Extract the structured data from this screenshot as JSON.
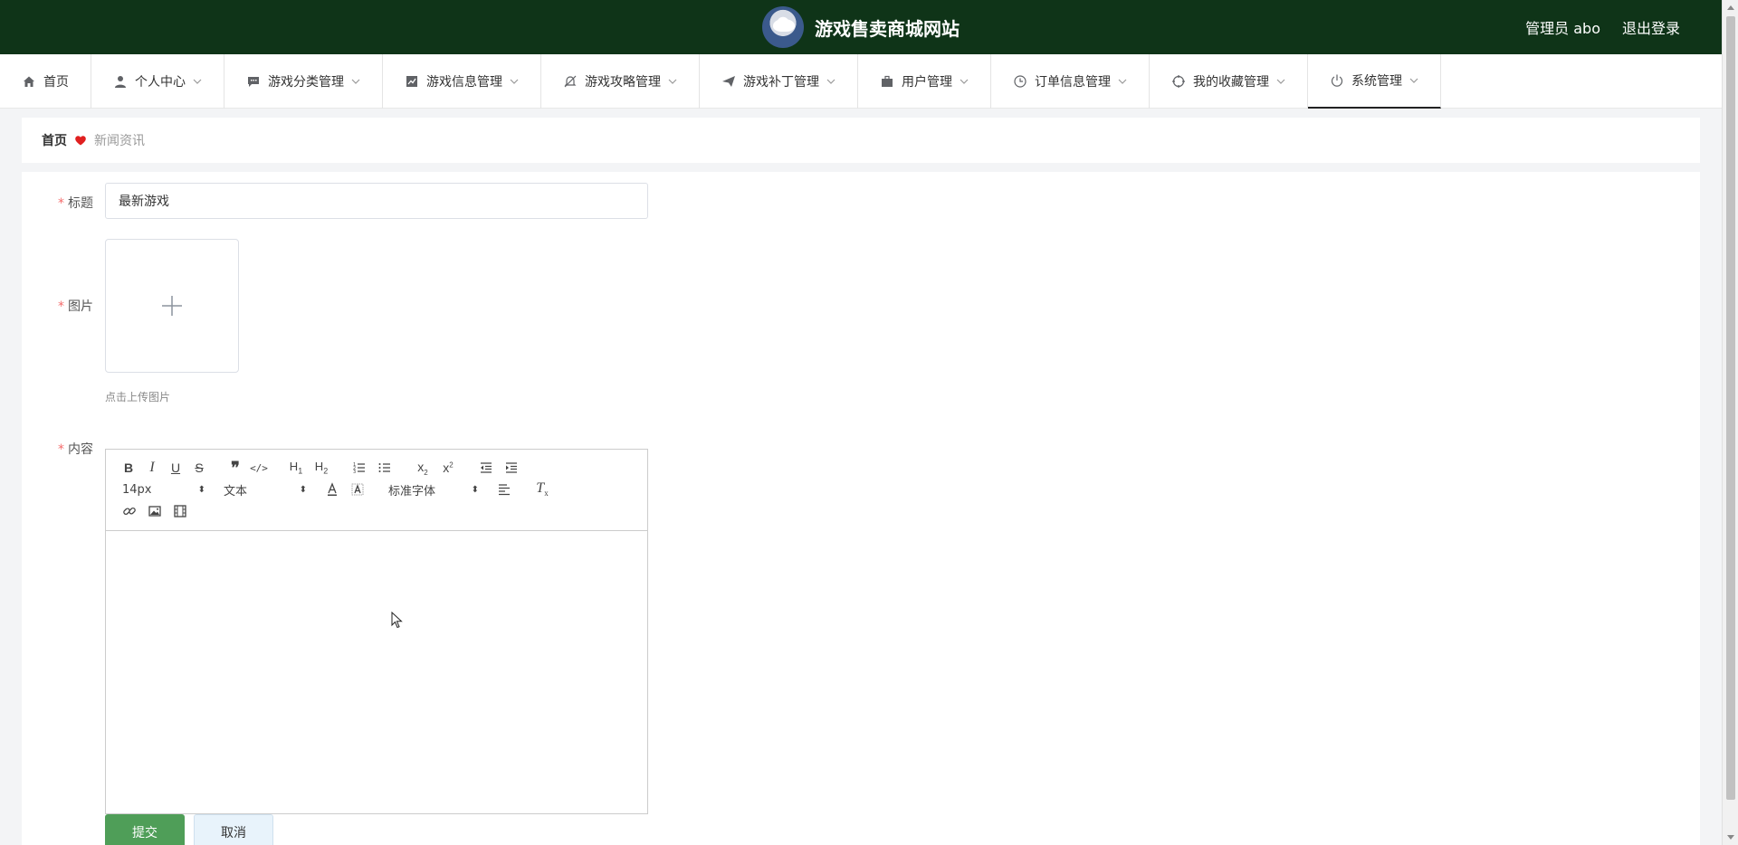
{
  "header": {
    "site_title": "游戏售卖商城网站",
    "admin_label": "管理员 abo",
    "logout_label": "退出登录",
    "bg_color": "#0f3418"
  },
  "nav": {
    "items": [
      {
        "label": "首页",
        "icon": "home-icon"
      },
      {
        "label": "个人中心",
        "icon": "user-icon"
      },
      {
        "label": "游戏分类管理",
        "icon": "chat-icon"
      },
      {
        "label": "游戏信息管理",
        "icon": "chart-icon"
      },
      {
        "label": "游戏攻略管理",
        "icon": "bell-off-icon"
      },
      {
        "label": "游戏补丁管理",
        "icon": "send-icon"
      },
      {
        "label": "用户管理",
        "icon": "briefcase-icon"
      },
      {
        "label": "订单信息管理",
        "icon": "clock-icon"
      },
      {
        "label": "我的收藏管理",
        "icon": "aim-icon"
      },
      {
        "label": "系统管理",
        "icon": "power-icon"
      }
    ],
    "active": "系统管理"
  },
  "breadcrumb": {
    "home": "首页",
    "current": "新闻资讯",
    "separator_icon": "heart-icon",
    "separator_color": "#e02020"
  },
  "form": {
    "title_label": "标题",
    "title_value": "最新游戏",
    "image_label": "图片",
    "upload_hint": "点击上传图片",
    "content_label": "内容",
    "required_mark": "*",
    "editor": {
      "size_value": "14px",
      "header_value": "文本",
      "font_value": "标准字体"
    },
    "submit_label": "提交",
    "cancel_label": "取消",
    "submit_color": "#4f9e58"
  }
}
